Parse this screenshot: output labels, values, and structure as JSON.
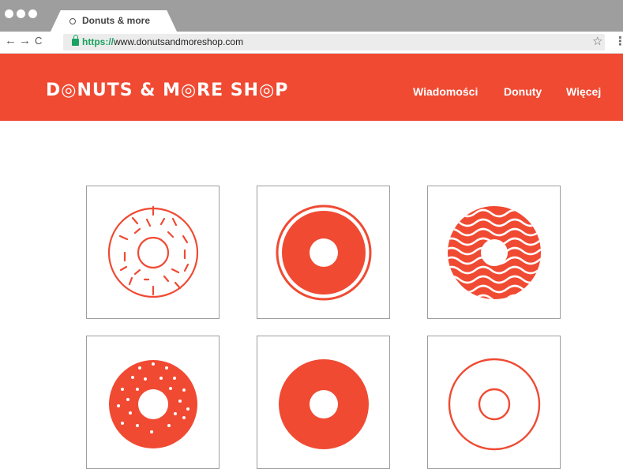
{
  "browser": {
    "tab_title": "Donuts & more",
    "url_scheme": "https://",
    "url_rest": "www.donutsandmoreshop.com",
    "nav_back": "←",
    "nav_forward": "→",
    "nav_reload": "C",
    "star": "☆",
    "menu": "⋮"
  },
  "site": {
    "logo": "D◎NUTS & M◎RE SH◎P",
    "nav": [
      "Wiadomości",
      "Donuty",
      "Więcej"
    ]
  },
  "products": [
    {
      "name": "sprinkle-outline-donut-icon"
    },
    {
      "name": "ringed-solid-donut-icon"
    },
    {
      "name": "wavy-glazed-donut-icon"
    },
    {
      "name": "dotted-sprinkle-donut-icon"
    },
    {
      "name": "solid-donut-icon"
    },
    {
      "name": "outline-donut-icon"
    }
  ],
  "colors": {
    "brand": "#f04a33",
    "chrome": "#9e9e9e",
    "secure": "#1aa260"
  }
}
